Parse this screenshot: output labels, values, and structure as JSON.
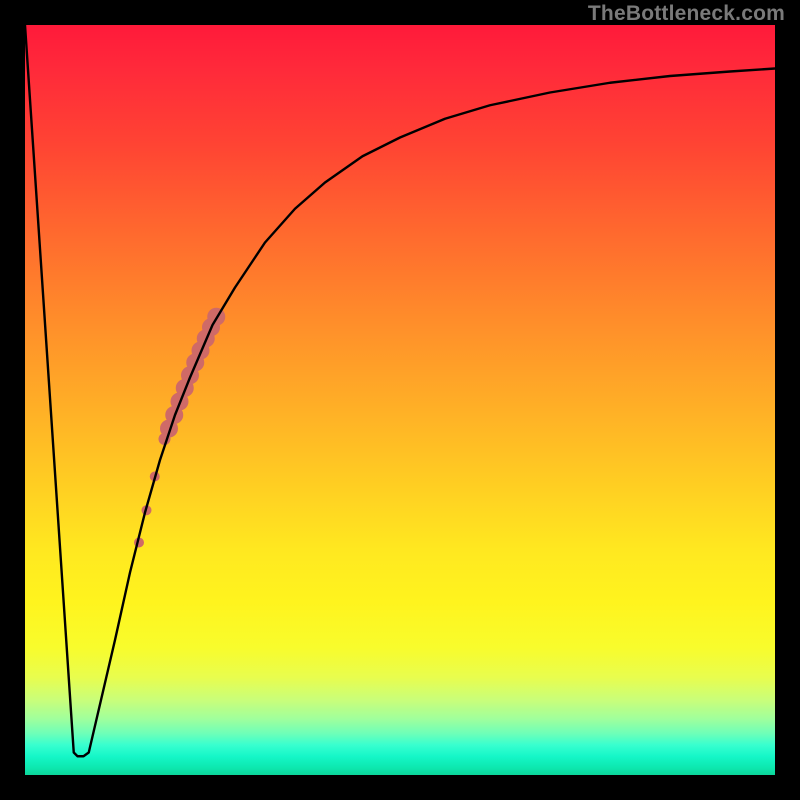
{
  "watermark": "TheBottleneck.com",
  "chart_data": {
    "type": "line",
    "title": "",
    "xlabel": "",
    "ylabel": "",
    "xlim": [
      0,
      100
    ],
    "ylim": [
      0,
      100
    ],
    "series": [
      {
        "name": "curve",
        "x": [
          0,
          6.5,
          7.0,
          7.8,
          8.5,
          12,
          14,
          16,
          18,
          20,
          22,
          25,
          28,
          32,
          36,
          40,
          45,
          50,
          56,
          62,
          70,
          78,
          86,
          94,
          100
        ],
        "values": [
          100,
          3,
          2.5,
          2.5,
          3,
          18,
          27,
          35,
          42,
          48,
          53,
          60,
          65,
          71,
          75.5,
          79,
          82.5,
          85,
          87.5,
          89.3,
          91,
          92.3,
          93.2,
          93.8,
          94.2
        ]
      }
    ],
    "markers": {
      "name": "highlight-segment",
      "color": "#cf6a67",
      "pts": [
        {
          "x": 15.2,
          "y": 31.0,
          "r": 5
        },
        {
          "x": 16.2,
          "y": 35.3,
          "r": 5
        },
        {
          "x": 17.3,
          "y": 39.8,
          "r": 5
        },
        {
          "x": 18.6,
          "y": 44.8,
          "r": 6
        },
        {
          "x": 19.2,
          "y": 46.2,
          "r": 9
        },
        {
          "x": 19.9,
          "y": 48.0,
          "r": 9
        },
        {
          "x": 20.6,
          "y": 49.8,
          "r": 9
        },
        {
          "x": 21.3,
          "y": 51.6,
          "r": 9
        },
        {
          "x": 22.0,
          "y": 53.3,
          "r": 9
        },
        {
          "x": 22.7,
          "y": 55.0,
          "r": 9
        },
        {
          "x": 23.4,
          "y": 56.6,
          "r": 9
        },
        {
          "x": 24.1,
          "y": 58.2,
          "r": 9
        },
        {
          "x": 24.8,
          "y": 59.7,
          "r": 9
        },
        {
          "x": 25.5,
          "y": 61.1,
          "r": 9
        }
      ]
    },
    "gradient_stops": [
      {
        "pos": 0.0,
        "color": "#ff1a3a"
      },
      {
        "pos": 0.4,
        "color": "#ff8f2a"
      },
      {
        "pos": 0.77,
        "color": "#fff41e"
      },
      {
        "pos": 0.95,
        "color": "#38ffcf"
      },
      {
        "pos": 1.0,
        "color": "#0cd59a"
      }
    ]
  }
}
